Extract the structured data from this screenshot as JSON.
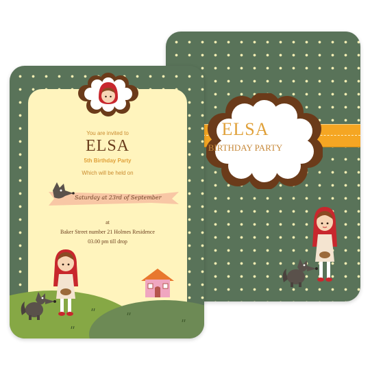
{
  "back_card": {
    "name": "ELSA",
    "subtitle": "BIRTHDAY PARTY"
  },
  "front_card": {
    "invite_line": "You are invited to",
    "name": "ELSA",
    "party": "5th Birthday Party",
    "held_on": "Which will be held on",
    "date": "Saturday at 23rd of September",
    "at": "at",
    "address": "Baker Street  number 21 Holmes Residence",
    "time": "03.00 pm till drop"
  },
  "colors": {
    "card_green": "#597359",
    "dots": "#f6f0b4",
    "panel": "#fff4bd",
    "title_brown": "#5c3a1e",
    "accent_orange": "#e0a13a",
    "ribbon": "#f8c7a5",
    "badge_stripe": "#f5a623"
  }
}
